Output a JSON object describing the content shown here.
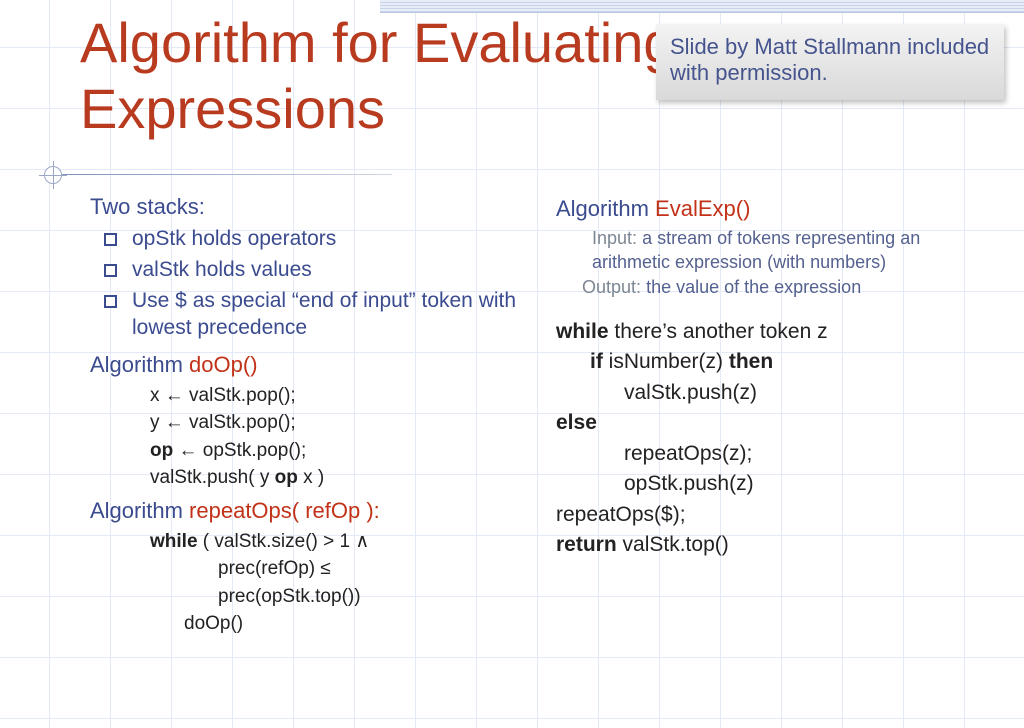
{
  "title": "Algorithm for Evaluating Expressions",
  "attribution": "Slide by Matt Stallmann included with permission.",
  "left": {
    "heading": "Two stacks:",
    "bullets": [
      "opStk holds operators",
      "valStk holds values",
      "Use $ as special  “end of input” token with lowest precedence"
    ],
    "algo1": {
      "label": "Algorithm",
      "name": "doOp()",
      "lines": [
        "x ← valStk.pop();",
        "y ← valStk.pop();",
        "op ← opStk.pop();",
        "valStk.push( y op x )"
      ]
    },
    "algo2": {
      "label": "Algorithm",
      "name": "repeatOps( refOp ):",
      "while_kw": "while",
      "while_cond": "( valStk.size() > 1 ∧",
      "cond2": "prec(refOp) ≤",
      "cond3": "prec(opStk.top())",
      "body": "doOp()"
    }
  },
  "right": {
    "algo_label": "Algorithm",
    "algo_name": "EvalExp()",
    "input_lab": "Input:",
    "input_txt": "a stream of tokens representing an arithmetic expression (with numbers)",
    "output_lab": "Output:",
    "output_txt": "the value of the expression",
    "code": {
      "l1a": "while",
      "l1b": "there’s another token z",
      "l2a": "if",
      "l2b": "isNumber(z)",
      "l2c": "then",
      "l3": "valStk.push(z)",
      "l4": "else",
      "l5": "repeatOps(z);",
      "l6": "opStk.push(z)",
      "l7": "repeatOps($);",
      "l8a": "return",
      "l8b": "valStk.top()"
    }
  }
}
